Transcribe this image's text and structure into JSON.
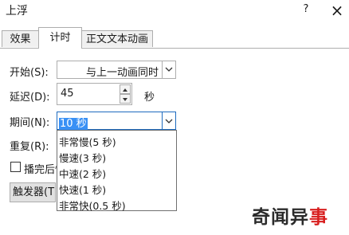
{
  "window": {
    "title": "上浮",
    "help_label": "?",
    "close_label": "×"
  },
  "tabs": [
    {
      "label": "效果"
    },
    {
      "label": "计时"
    },
    {
      "label": "正文文本动画"
    }
  ],
  "start": {
    "label": "开始(S):",
    "value": "与上一动画同时"
  },
  "delay": {
    "label": "延迟(D):",
    "value": "45",
    "unit": "秒"
  },
  "duration": {
    "label": "期间(N):",
    "value": "10 秒",
    "options": [
      "非常慢(5 秒)",
      "慢速(3 秒)",
      "中速(2 秒)",
      "快速(1 秒)",
      "非常快(0.5 秒)"
    ]
  },
  "repeat": {
    "label": "重复(R):"
  },
  "rewind": {
    "label": "播完后快"
  },
  "triggers": {
    "label": "触发器(T)"
  },
  "watermark": {
    "text_main": "奇闻异",
    "text_accent": "事"
  }
}
